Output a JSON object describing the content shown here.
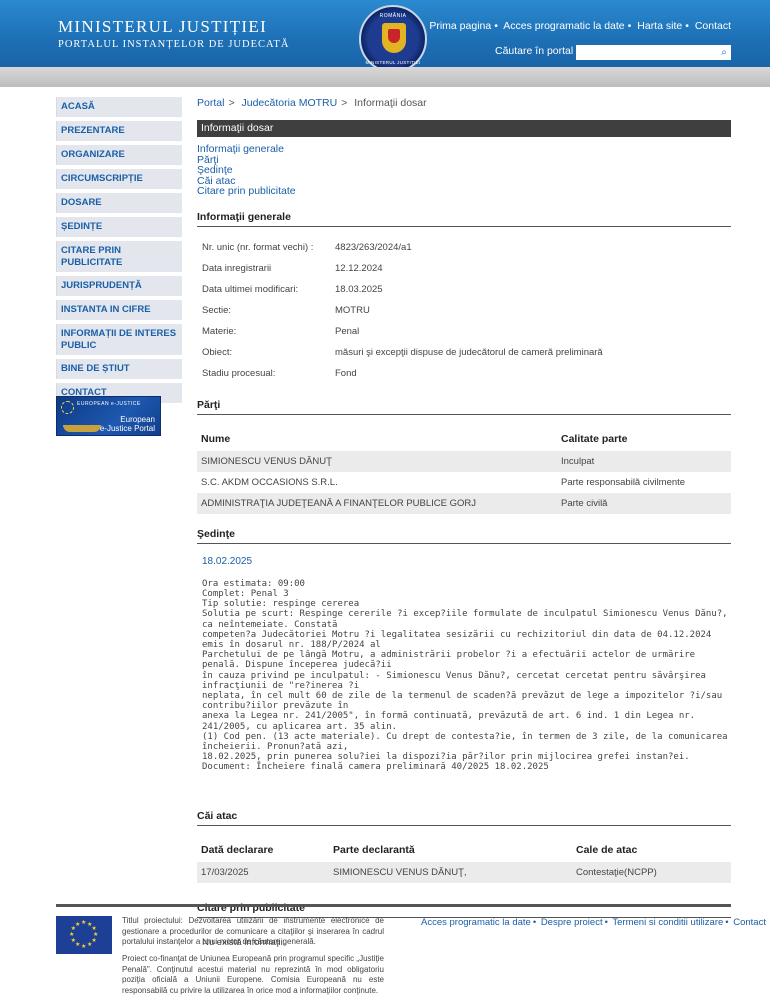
{
  "header": {
    "title_line1": "MINISTERUL JUSTIȚIEI",
    "title_line2": "PORTALUL INSTANȚELOR DE JUDECATĂ",
    "nav": [
      "Prima pagina",
      "Acces programatic la date",
      "Harta site",
      "Contact"
    ],
    "search_label": "Căutare în portal",
    "emblem_top": "ROMÂNIA",
    "emblem_bottom": "MINISTERUL JUSTIȚIEI"
  },
  "sidebar": {
    "items": [
      "ACASĂ",
      "PREZENTARE",
      "ORGANIZARE",
      "CIRCUMSCRIPȚIE",
      "DOSARE",
      "ȘEDINȚE",
      "CITARE PRIN PUBLICITATE",
      "JURISPRUDENȚĂ",
      "INSTANTA IN CIFRE",
      "INFORMAȚII DE INTERES PUBLIC",
      "BINE DE ȘTIUT",
      "CONTACT"
    ],
    "ejustice_small": "EUROPEAN e-JUSTICE",
    "ejustice_big_1": "European",
    "ejustice_big_2": "e-Justice Portal"
  },
  "breadcrumb": [
    "Portal",
    "Judecătoria MOTRU",
    "Informaţii dosar"
  ],
  "page_title": "Informaţii dosar",
  "anchors": [
    "Informaţii generale",
    "Părţi",
    "Şedinţe",
    "Căi atac",
    "Citare prin publicitate"
  ],
  "general": {
    "title": "Informaţii generale",
    "rows": [
      {
        "k": "Nr. unic (nr. format vechi) :",
        "v": "4823/263/2024/a1"
      },
      {
        "k": "Data inregistrarii",
        "v": "12.12.2024"
      },
      {
        "k": "Data ultimei modificari:",
        "v": "18.03.2025"
      },
      {
        "k": "Sectie:",
        "v": "MOTRU"
      },
      {
        "k": "Materie:",
        "v": "Penal"
      },
      {
        "k": "Obiect:",
        "v": "măsuri şi excepţii dispuse de judecătorul de cameră preliminară"
      },
      {
        "k": "Stadiu procesual:",
        "v": "Fond"
      }
    ]
  },
  "parti": {
    "title": "Părţi",
    "headers": [
      "Nume",
      "Calitate parte"
    ],
    "rows": [
      [
        "SIMIONESCU VENUS DĂNUŢ",
        "Inculpat"
      ],
      [
        "S.C. AKDM OCCASIONS S.R.L.",
        "Parte responsabilă civilmente"
      ],
      [
        "ADMINISTRAŢIA JUDEŢEANĂ A FINANŢELOR PUBLICE GORJ",
        "Parte civilă"
      ]
    ]
  },
  "sedinte": {
    "title": "Şedinţe",
    "date": "18.02.2025",
    "lines": [
      "Ora estimata: 09:00",
      "Complet: Penal 3",
      "Tip solutie: respinge cererea",
      "Solutia pe scurt: Respinge cererile ?i excep?iile formulate de inculpatul Simionescu Venus Dănu?, ca neîntemeiate. Constată",
      "competen?a Judecătoriei Motru ?i legalitatea sesizării cu rechizitoriul din data de 04.12.2024 emis în dosarul nr. 188/P/2024 al",
      "Parchetului de pe lângă Motru, a administrării probelor ?i a efectuării actelor de urmărire penală. Dispune începerea judecă?ii",
      "în cauza privind pe inculpatul: - Simionescu Venus Dănu?, cercetat cercetat pentru săvârşirea infracţiunii de \"re?inerea ?i",
      "neplata, în cel mult 60 de zile de la termenul de scaden?ă prevăzut de lege a impozitelor ?i/sau contribu?iilor prevăzute în",
      "anexa la Legea nr. 241/2005\", în formă continuată, prevăzută de art. 6 ind. 1 din Legea nr. 241/2005, cu aplicarea art. 35 alin.",
      "(1) Cod pen. (13 acte materiale). Cu drept de contesta?ie, în termen de 3 zile, de la comunicarea încheierii. Pronun?ată azi,",
      "18.02.2025, prin punerea solu?iei la dispozi?ia păr?ilor prin mijlocirea grefei instan?ei.",
      "Document: Încheiere finală camera preliminară  40/2025  18.02.2025"
    ]
  },
  "cai_atac": {
    "title": "Căi atac",
    "headers": [
      "Dată declarare",
      "Parte declarantă",
      "Cale de atac"
    ],
    "rows": [
      [
        "17/03/2025",
        "SIMIONESCU VENUS DĂNUŢ,",
        "Contestaţie(NCPP)"
      ]
    ]
  },
  "citare": {
    "title": "Citare prin publicitate",
    "text": "Nu există informaţii."
  },
  "footer": {
    "text1": "Titlul proiectului: Dezvoltarea utilizării de instrumente electronice de gestionare a procedurilor de comunicare a citaţiilor şi inserarea în cadrul portalului instanţelor a unui motor de căutare generală.",
    "text2": "Proiect co-finanţat de Uniunea Europeană prin programul specific „Justiţie Penală\". Conţinutul acestui material nu reprezintă în mod obligatoriu poziţia oficială a Uniunii Europene. Comisia Europeană nu este responsabilă cu privire la utilizarea în orice mod a informaţiilor conţinute.",
    "links": [
      "Acces programatic la date",
      "Despre proiect",
      "Termeni si conditii utilizare",
      "Contact"
    ]
  },
  "colors": {
    "header_blue": "#1d6fb5",
    "link": "#1a5fa8",
    "dark_bar": "#3f3f3f",
    "sidebar_bg": "#e3e7ed"
  }
}
